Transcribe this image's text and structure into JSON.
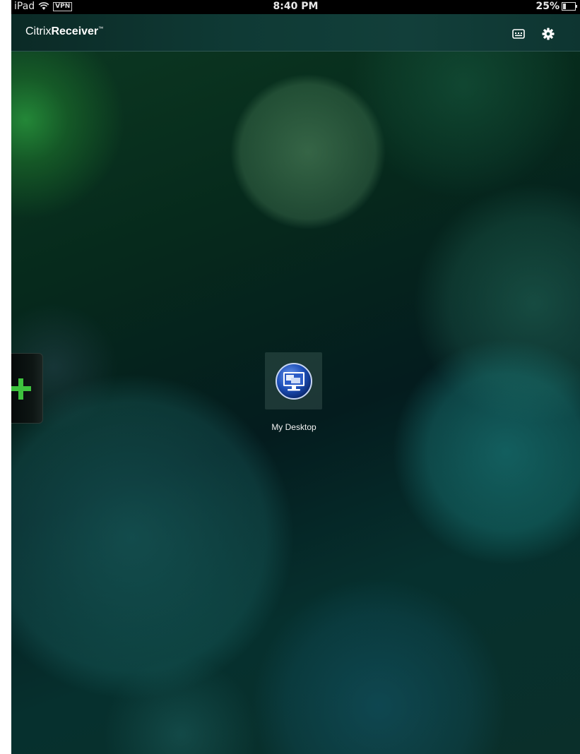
{
  "status_bar": {
    "device": "iPad",
    "vpn": "VPN",
    "time": "8:40 PM",
    "battery_percent": "25%",
    "battery_level": 0.25
  },
  "header": {
    "brand_light": "Citrix",
    "brand_bold": "Receiver",
    "brand_mark": "™"
  },
  "toolbar_icons": [
    "keyboard-icon",
    "gear-icon"
  ],
  "side_tab": {
    "icon": "plus-icon"
  },
  "apps": [
    {
      "label": "My Desktop",
      "icon": "desktop-monitor-icon"
    }
  ],
  "colors": {
    "plus_green": "#3ec23e",
    "icon_blue": "#1d4fb8"
  }
}
